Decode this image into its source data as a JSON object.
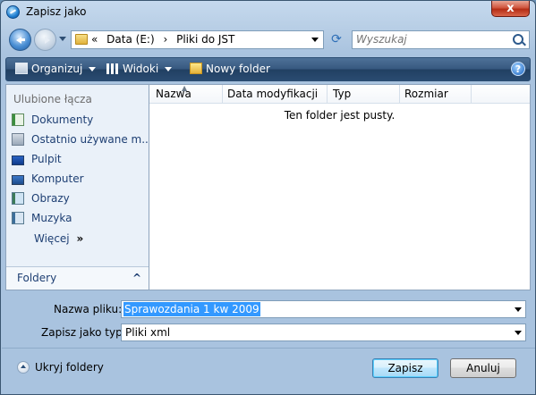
{
  "window": {
    "title": "Zapisz jako",
    "close_label": "x"
  },
  "address": {
    "overflow": "«",
    "crumbs": [
      "Data (E:)",
      "Pliki do JST"
    ],
    "separator": "›"
  },
  "search": {
    "placeholder": "Wyszukaj"
  },
  "toolbar": {
    "organize_label": "Organizuj",
    "views_label": "Widoki",
    "new_folder_label": "Nowy folder",
    "help_label": "?"
  },
  "nav": {
    "header": "Ulubione łącza",
    "items": [
      {
        "label": "Dokumenty",
        "icon": "documents-icon"
      },
      {
        "label": "Ostatnio używane m...",
        "icon": "recent-places-icon"
      },
      {
        "label": "Pulpit",
        "icon": "desktop-icon"
      },
      {
        "label": "Komputer",
        "icon": "computer-icon"
      },
      {
        "label": "Obrazy",
        "icon": "pictures-icon"
      },
      {
        "label": "Muzyka",
        "icon": "music-icon"
      }
    ],
    "more_label": "Więcej",
    "more_chevron": "»",
    "folders_label": "Foldery",
    "folders_chevron": "^"
  },
  "filelist": {
    "columns": [
      "Nazwa",
      "Data modyfikacji",
      "Typ",
      "Rozmiar"
    ],
    "empty_message": "Ten folder jest pusty."
  },
  "form": {
    "filename_label": "Nazwa pliku:",
    "filename_value": "Sprawozdania 1 kw 2009",
    "filetype_label": "Zapisz jako typ:",
    "filetype_value": "Pliki xml"
  },
  "footer": {
    "hide_folders_label": "Ukryj foldery",
    "save_label": "Zapisz",
    "cancel_label": "Anuluj"
  },
  "colors": {
    "accent": "#3399ff",
    "toolbar": "#2a4b71",
    "close": "#c8432b"
  }
}
